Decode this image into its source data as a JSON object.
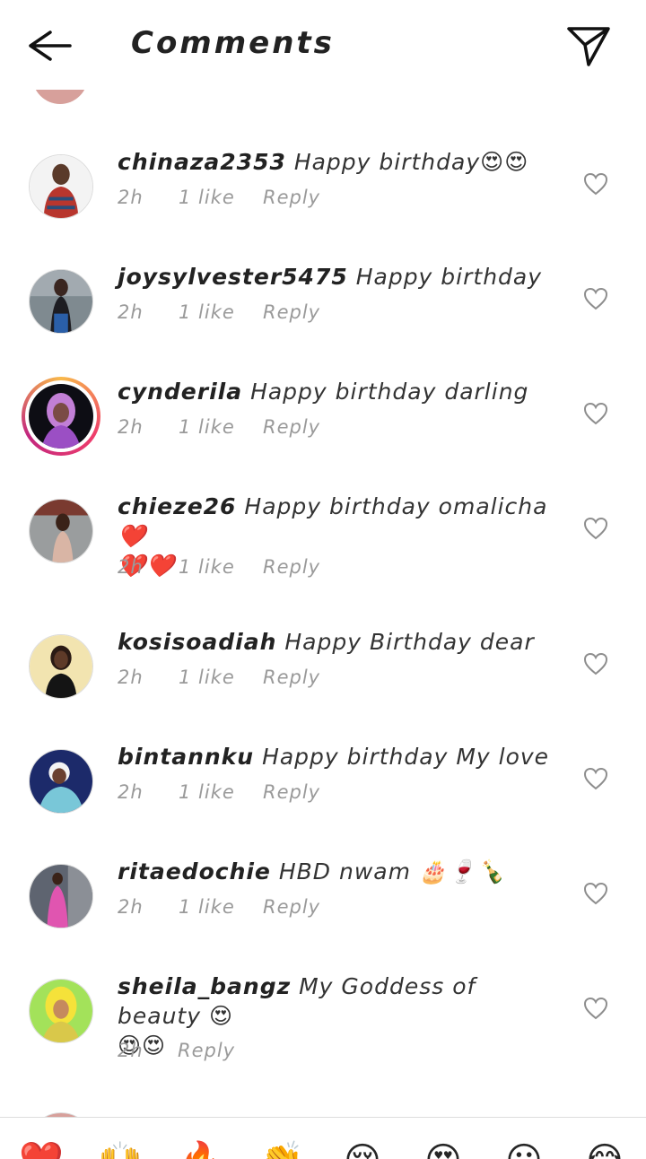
{
  "header": {
    "title": "Comments"
  },
  "comments": [
    {
      "username": "chinaza2353",
      "text": "Happy birthday😍😍",
      "time": "2h",
      "likes": "1 like",
      "reply": "Reply"
    },
    {
      "username": "joysylvester5475",
      "text": "Happy birthday",
      "time": "2h",
      "likes": "1 like",
      "reply": "Reply"
    },
    {
      "username": "cynderila",
      "text": "Happy birthday darling",
      "time": "2h",
      "likes": "1 like",
      "reply": "Reply"
    },
    {
      "username": "chieze26",
      "text": "Happy birthday omalicha ❤️",
      "text2": "❤️❤️",
      "time": "2h",
      "likes": "1 like",
      "reply": "Reply"
    },
    {
      "username": "kosisoadiah",
      "text": "Happy Birthday dear",
      "time": "2h",
      "likes": "1 like",
      "reply": "Reply"
    },
    {
      "username": "bintannku",
      "text": "Happy birthday My love",
      "time": "2h",
      "likes": "1 like",
      "reply": "Reply"
    },
    {
      "username": "ritaedochie",
      "text": "HBD nwam 🎂🍷🍾",
      "time": "2h",
      "likes": "1 like",
      "reply": "Reply"
    },
    {
      "username": "sheila_bangz",
      "text": "My Goddess of beauty 😍",
      "text2": "😍😍",
      "time": "2h",
      "reply": "Reply"
    }
  ],
  "quick_reactions": [
    "❤️",
    "🙌",
    "🔥",
    "👏",
    "😢",
    "😍",
    "😮",
    "😂"
  ],
  "colors": {
    "like_heart": "#d72222",
    "meta_text": "#9a9a9a",
    "story_ring": [
      "#f8b94a",
      "#ee3d6b",
      "#c2277f"
    ]
  }
}
